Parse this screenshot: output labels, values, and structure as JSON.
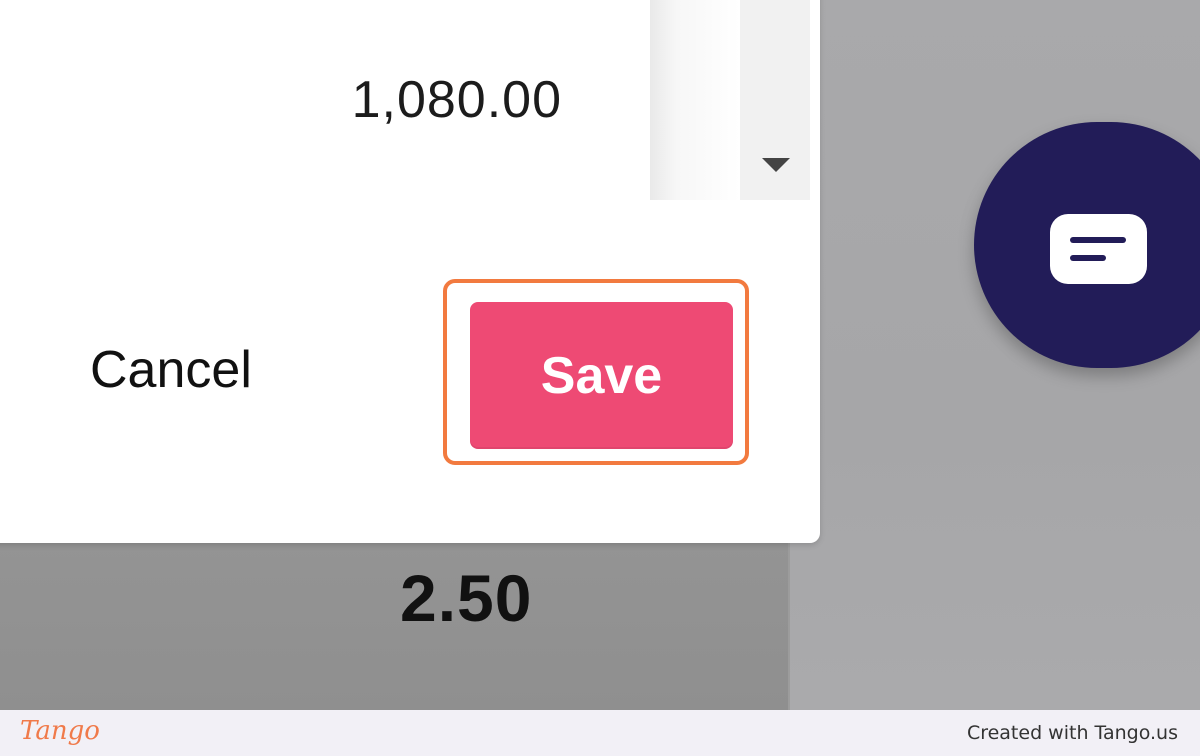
{
  "dialog": {
    "amount_value": "1,080.00",
    "cancel_label": "Cancel",
    "save_label": "Save"
  },
  "background": {
    "value_below": "2.50"
  },
  "footer": {
    "logo_text": "Tango",
    "created_with": "Created with Tango.us"
  },
  "icons": {
    "dropdown": "caret-down-icon",
    "chat": "chat-bubble-icon"
  },
  "colors": {
    "save_button": "#ee4a74",
    "highlight_outline": "#f27a3f",
    "chat_fab": "#221c58",
    "brand_logo": "#f07a4a"
  }
}
